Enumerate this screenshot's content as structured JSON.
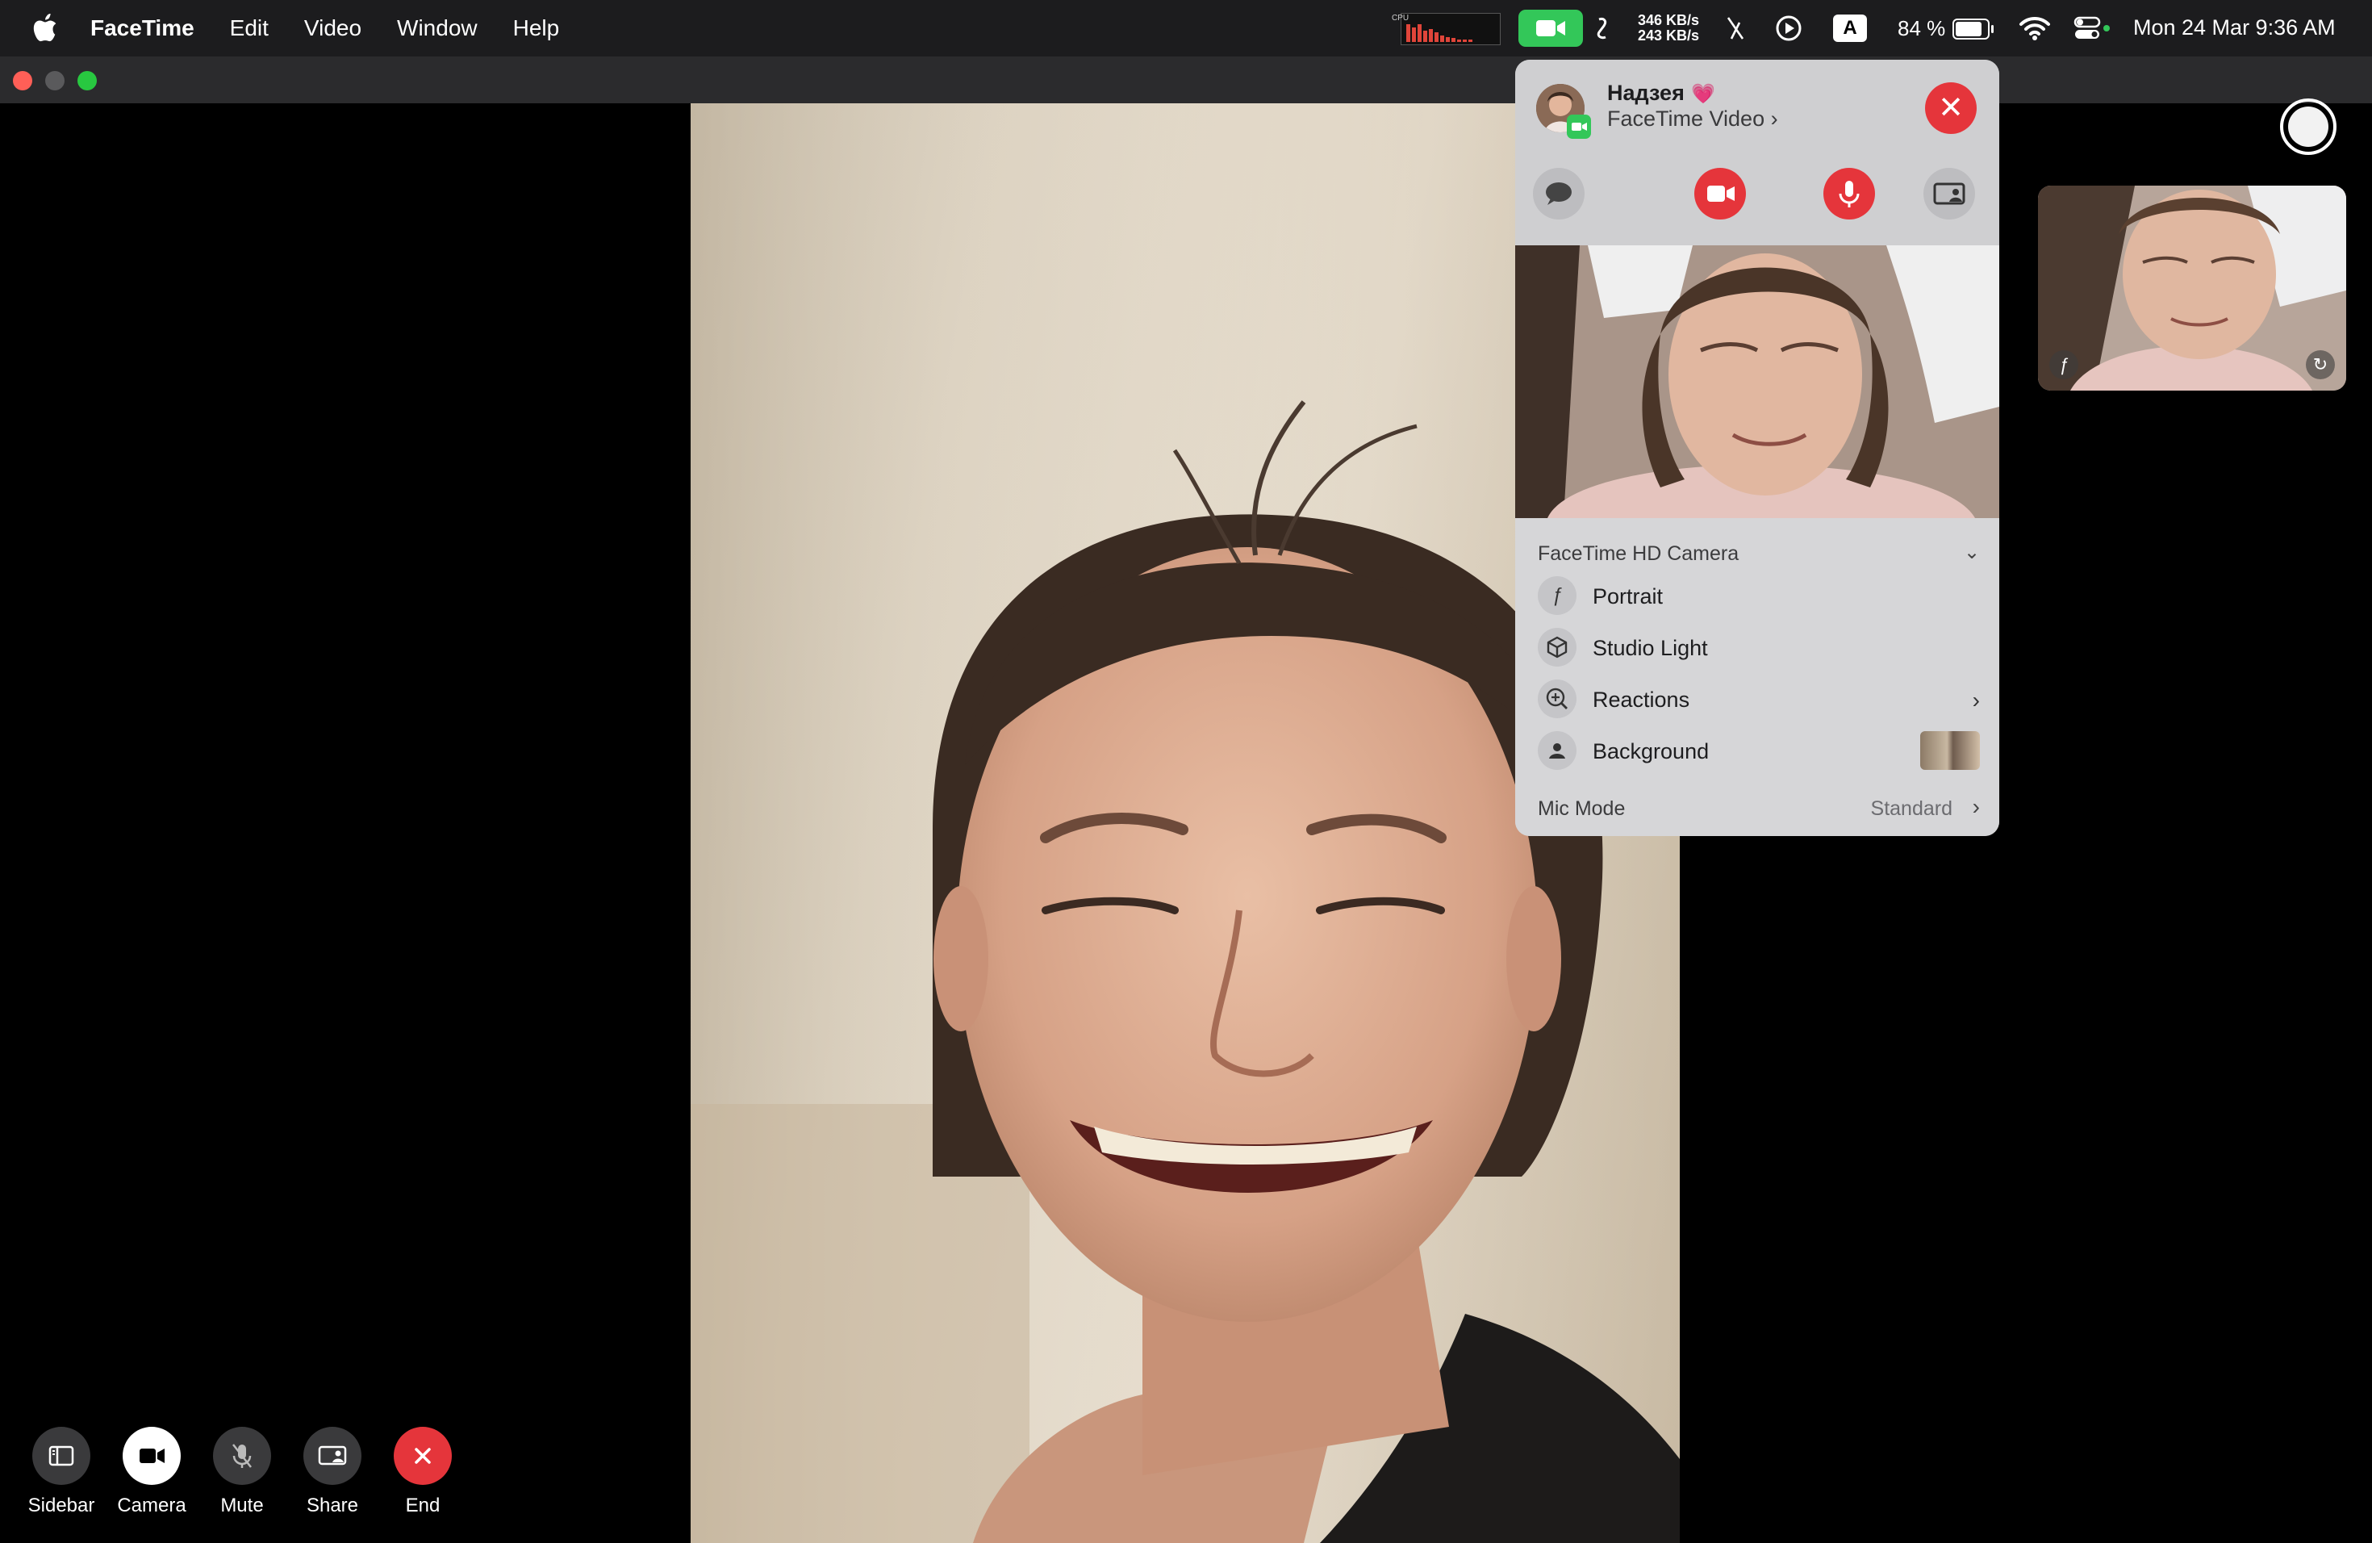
{
  "menubar": {
    "app_name": "FaceTime",
    "menus": [
      "Edit",
      "Video",
      "Window",
      "Help"
    ],
    "cpu_label": "CPU",
    "net_up": "346 KB/s",
    "net_down": "243 KB/s",
    "input_source": "A",
    "battery_percent": "84 %",
    "battery_level": 0.84,
    "clock": "Mon 24 Mar  9:36 AM"
  },
  "call_panel": {
    "caller_name": "Надзея",
    "caller_emoji": "💗",
    "call_type": "FaceTime Video",
    "camera_section": "FaceTime HD Camera",
    "effects": [
      {
        "label": "Portrait",
        "icon": "portrait-f-icon"
      },
      {
        "label": "Studio Light",
        "icon": "cube-icon"
      },
      {
        "label": "Reactions",
        "icon": "reactions-icon"
      },
      {
        "label": "Background",
        "icon": "person-icon"
      }
    ],
    "mic_mode_label": "Mic Mode",
    "mic_mode_value": "Standard"
  },
  "controls": [
    {
      "label": "Sidebar",
      "icon": "sidebar-icon"
    },
    {
      "label": "Camera",
      "icon": "camera-icon"
    },
    {
      "label": "Mute",
      "icon": "mic-slash-icon"
    },
    {
      "label": "Share",
      "icon": "share-screen-icon"
    },
    {
      "label": "End",
      "icon": "close-icon"
    }
  ],
  "colors": {
    "end_red": "#e5353b",
    "facetime_green": "#33c759",
    "menubar_bg": "#1c1c1e"
  }
}
